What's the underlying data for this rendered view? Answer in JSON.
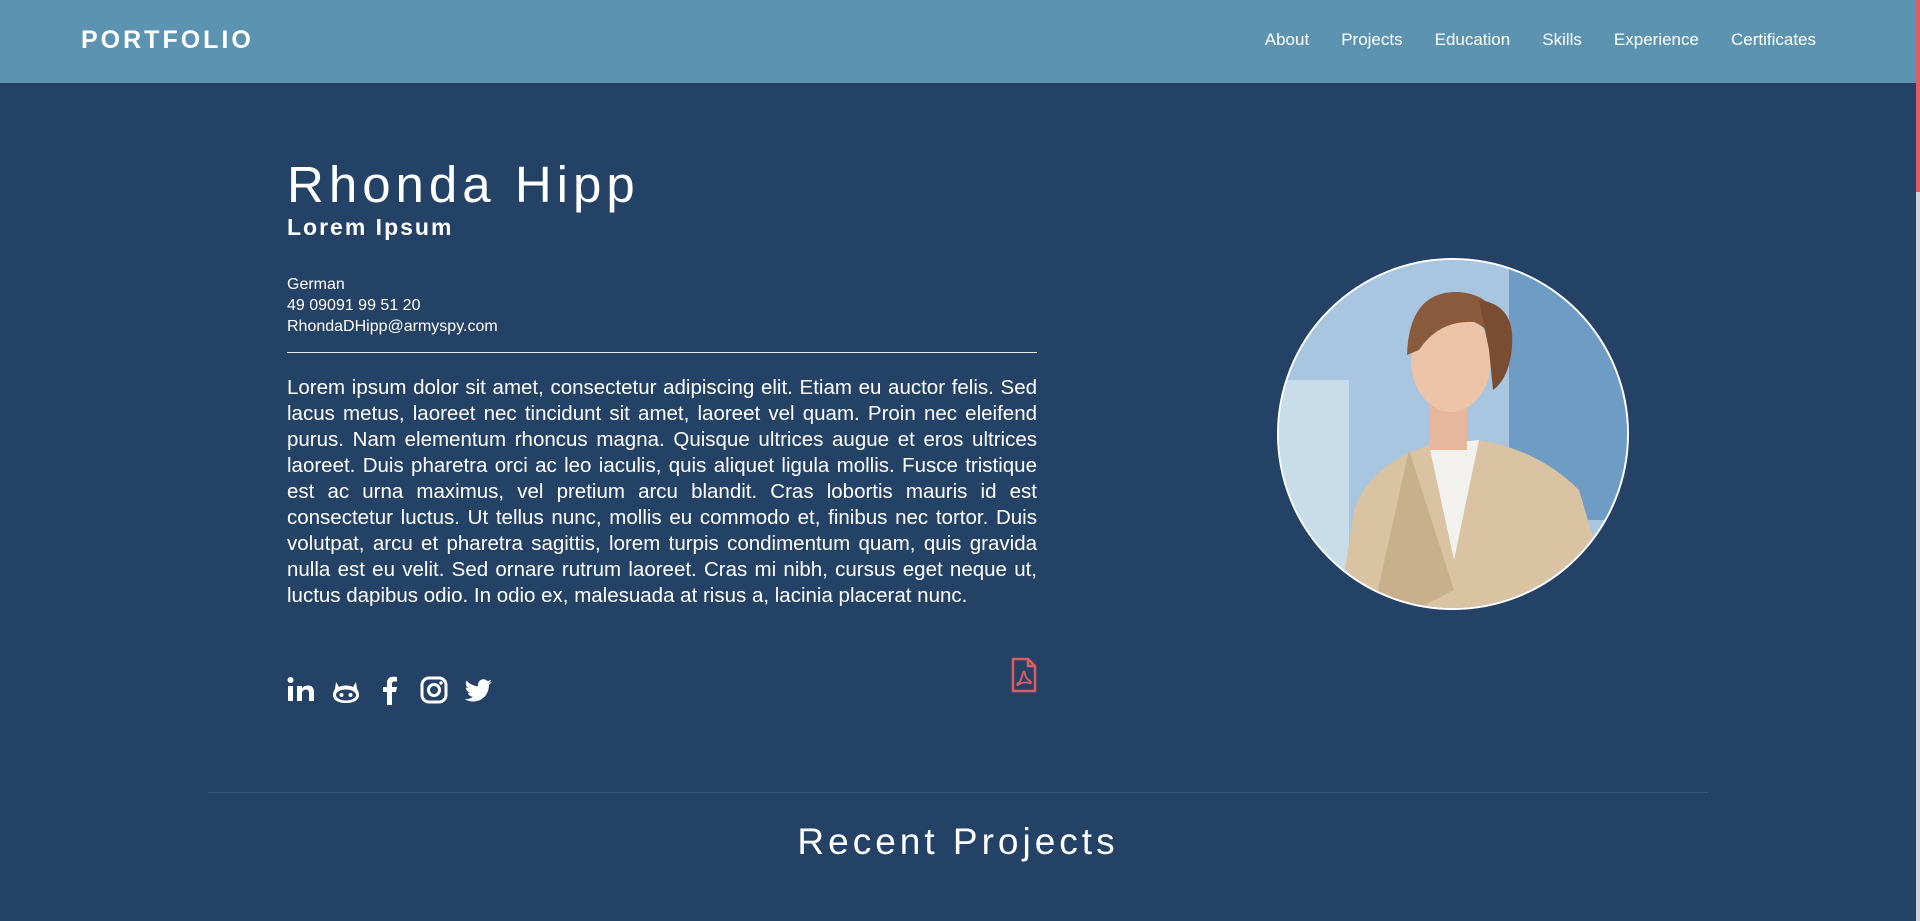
{
  "nav": {
    "brand": "PORTFOLIO",
    "links": [
      "About",
      "Projects",
      "Education",
      "Skills",
      "Experience",
      "Certificates"
    ]
  },
  "profile": {
    "name": "Rhonda Hipp",
    "subtitle": "Lorem Ipsum",
    "nationality": "German",
    "phone": "49 09091 99 51 20",
    "email": "RhondaDHipp@armyspy.com",
    "bio": "Lorem ipsum dolor sit amet, consectetur adipiscing elit. Etiam eu auctor felis. Sed lacus metus, laoreet nec tincidunt sit amet, laoreet vel quam. Proin nec eleifend purus. Nam elementum rhoncus magna. Quisque ultrices augue et eros ultrices laoreet. Duis pharetra orci ac leo iaculis, quis aliquet ligula mollis. Fusce tristique est ac urna maximus, vel pretium arcu blandit. Cras lobortis mauris id est consectetur luctus. Ut tellus nunc, mollis eu commodo et, finibus nec tortor. Duis volutpat, arcu et pharetra sagittis, lorem turpis condimentum quam, quis gravida nulla est eu velit. Sed ornare rutrum laoreet. Cras mi nibh, cursus eget neque ut, luctus dapibus odio. In odio ex, malesuada at risus a, lacinia placerat nunc."
  },
  "social_icons": [
    "linkedin-icon",
    "github-icon",
    "facebook-icon",
    "instagram-icon",
    "twitter-icon"
  ],
  "resume_icon": "pdf-file-icon",
  "sections": {
    "recent_projects_title": "Recent Projects"
  },
  "colors": {
    "navbar": "#5b93b1",
    "background": "#244266",
    "accent": "#e05c63",
    "text": "#ffffff"
  }
}
